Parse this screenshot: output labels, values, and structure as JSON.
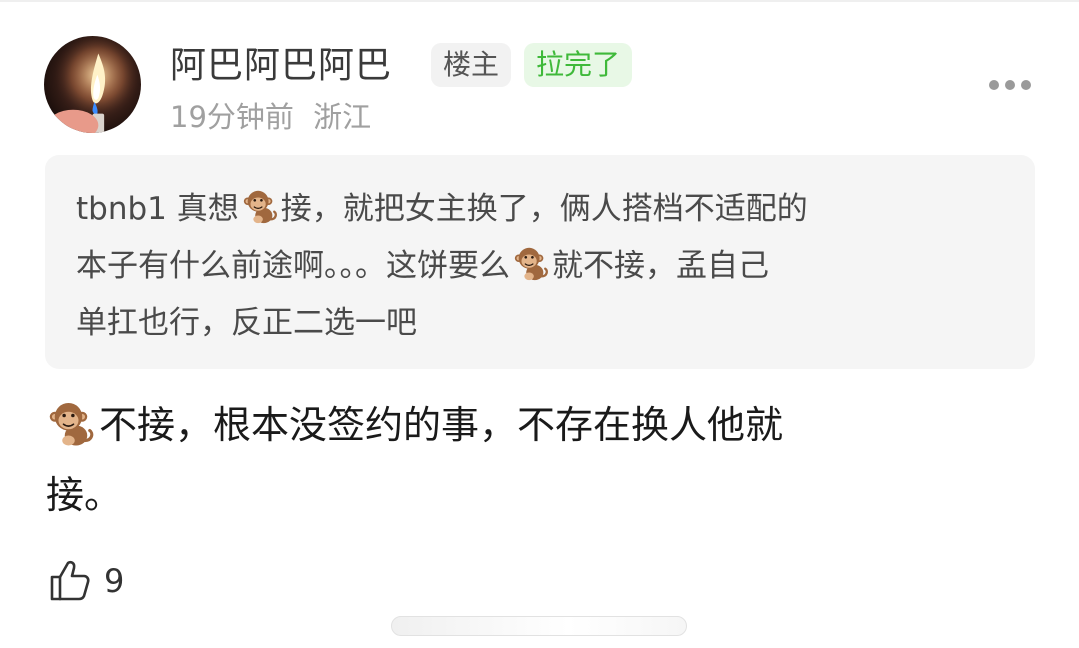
{
  "comment": {
    "author": {
      "name": "阿巴阿巴阿巴",
      "badges": {
        "owner": "楼主",
        "status": "拉完了"
      },
      "time": "19分钟前",
      "location": "浙江"
    },
    "quote": {
      "segments": [
        {
          "type": "text",
          "value": "tbnb1 真想"
        },
        {
          "type": "emoji",
          "value": "monkey-emoji"
        },
        {
          "type": "text",
          "value": "接，就把女主换了，俩人搭档不适配的\n本子有什么前途啊。。。这饼要么"
        },
        {
          "type": "emoji",
          "value": "monkey-emoji"
        },
        {
          "type": "text",
          "value": "就不接，孟自己\n单扛也行，反正二选一吧"
        }
      ]
    },
    "body": {
      "segments": [
        {
          "type": "emoji",
          "value": "monkey-emoji"
        },
        {
          "type": "text",
          "value": "不接，根本没签约的事，不存在换人他就\n接。"
        }
      ]
    },
    "likes": "9"
  },
  "icons": {
    "more": "more-dots-icon",
    "like": "thumbs-up-icon",
    "emoji": "monkey-emoji"
  },
  "colors": {
    "status_badge_text": "#3fb93a",
    "status_badge_bg": "#e8f8e6",
    "owner_badge_bg": "#f2f2f2",
    "quote_bg": "#f5f5f5",
    "meta_text": "#a0a0a0"
  }
}
